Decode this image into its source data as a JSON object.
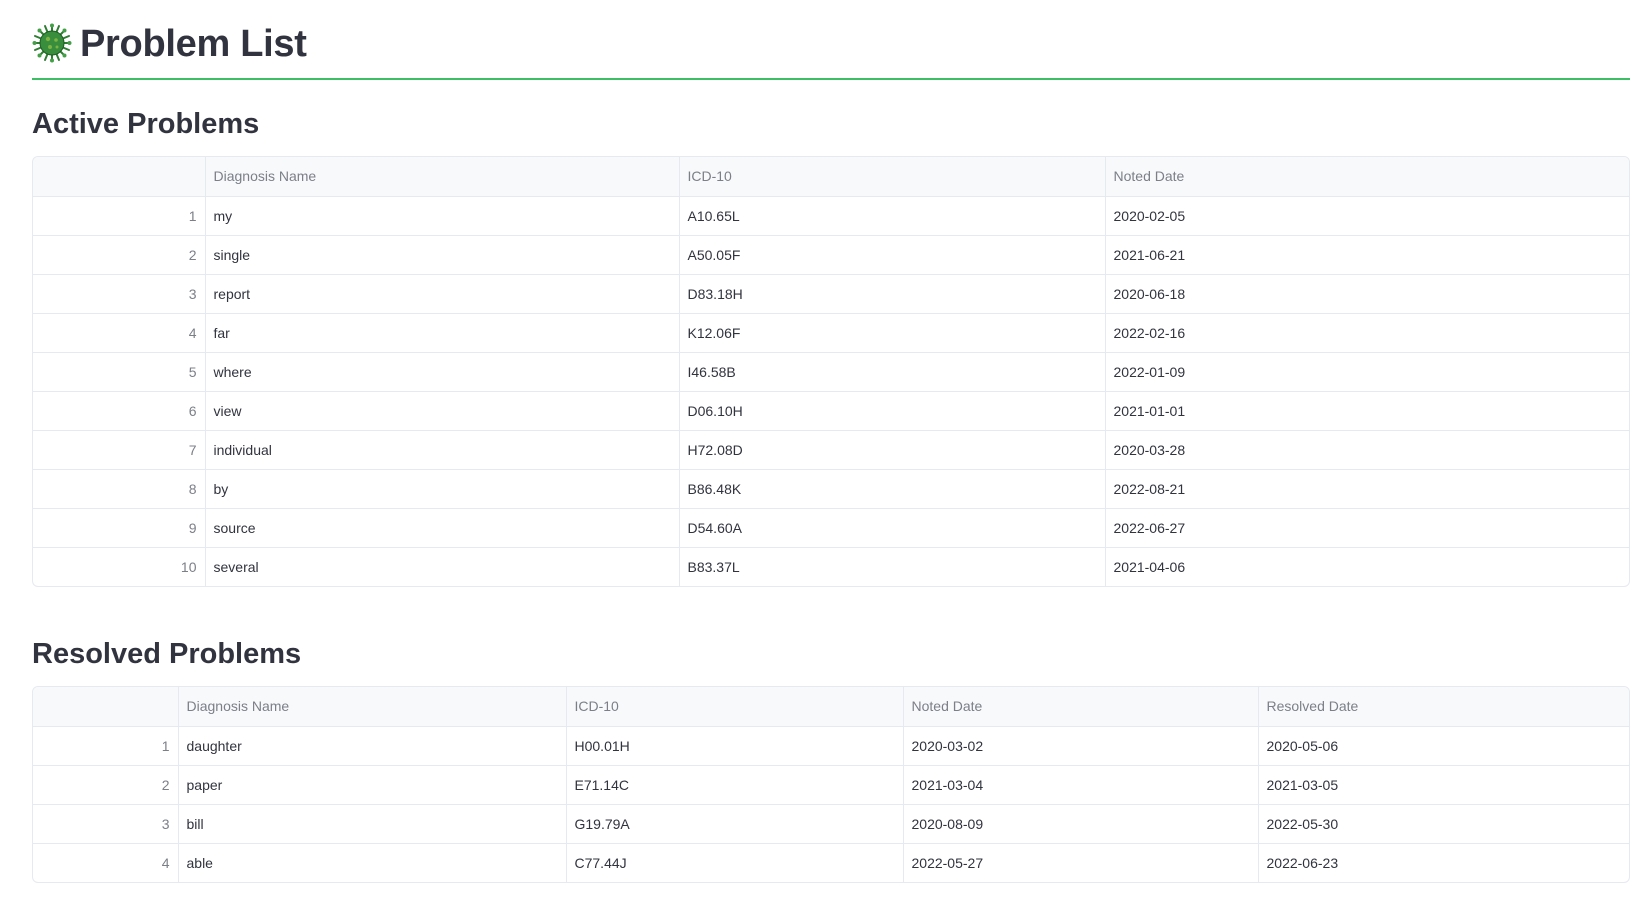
{
  "header": {
    "title": "Problem List",
    "icon": "virus-icon",
    "accent_color": "#3dbe65"
  },
  "active": {
    "title": "Active Problems",
    "columns": [
      "",
      "Diagnosis Name",
      "ICD-10",
      "Noted Date"
    ],
    "rows": [
      {
        "idx": "1",
        "name": "my",
        "icd": "A10.65L",
        "noted": "2020-02-05"
      },
      {
        "idx": "2",
        "name": "single",
        "icd": "A50.05F",
        "noted": "2021-06-21"
      },
      {
        "idx": "3",
        "name": "report",
        "icd": "D83.18H",
        "noted": "2020-06-18"
      },
      {
        "idx": "4",
        "name": "far",
        "icd": "K12.06F",
        "noted": "2022-02-16"
      },
      {
        "idx": "5",
        "name": "where",
        "icd": "I46.58B",
        "noted": "2022-01-09"
      },
      {
        "idx": "6",
        "name": "view",
        "icd": "D06.10H",
        "noted": "2021-01-01"
      },
      {
        "idx": "7",
        "name": "individual",
        "icd": "H72.08D",
        "noted": "2020-03-28"
      },
      {
        "idx": "8",
        "name": "by",
        "icd": "B86.48K",
        "noted": "2022-08-21"
      },
      {
        "idx": "9",
        "name": "source",
        "icd": "D54.60A",
        "noted": "2022-06-27"
      },
      {
        "idx": "10",
        "name": "several",
        "icd": "B83.37L",
        "noted": "2021-04-06"
      }
    ]
  },
  "resolved": {
    "title": "Resolved Problems",
    "columns": [
      "",
      "Diagnosis Name",
      "ICD-10",
      "Noted Date",
      "Resolved Date"
    ],
    "rows": [
      {
        "idx": "1",
        "name": "daughter",
        "icd": "H00.01H",
        "noted": "2020-03-02",
        "resolved": "2020-05-06"
      },
      {
        "idx": "2",
        "name": "paper",
        "icd": "E71.14C",
        "noted": "2021-03-04",
        "resolved": "2021-03-05"
      },
      {
        "idx": "3",
        "name": "bill",
        "icd": "G19.79A",
        "noted": "2020-08-09",
        "resolved": "2022-05-30"
      },
      {
        "idx": "4",
        "name": "able",
        "icd": "C77.44J",
        "noted": "2022-05-27",
        "resolved": "2022-06-23"
      }
    ]
  }
}
